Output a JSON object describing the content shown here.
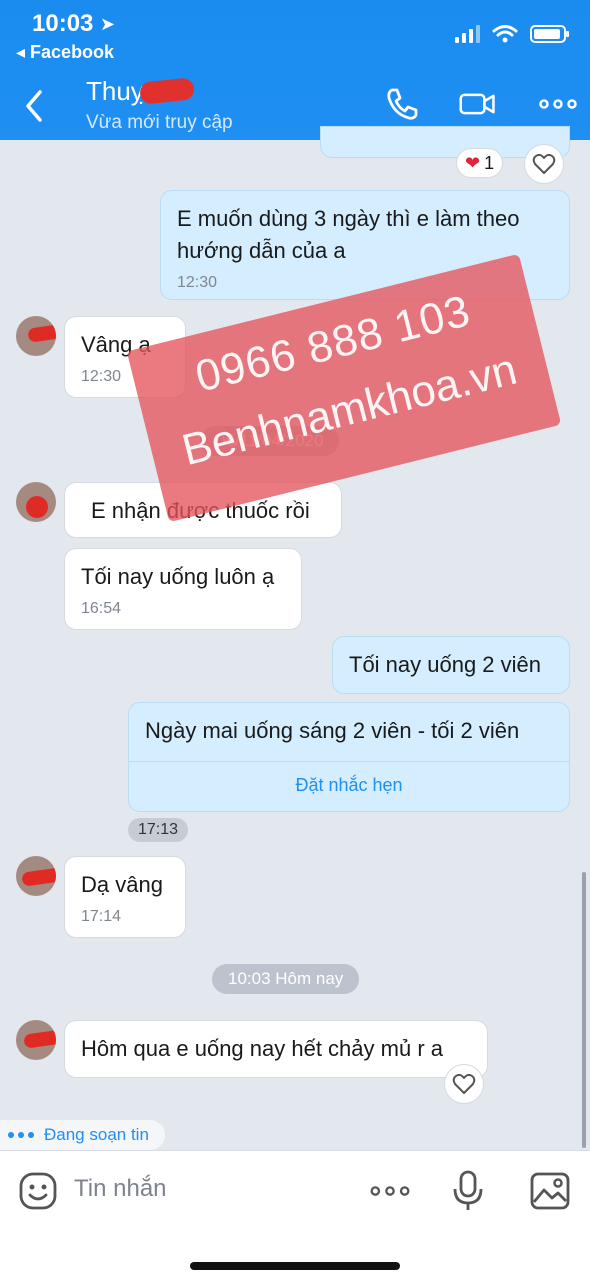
{
  "status": {
    "time": "10:03",
    "back_app": "◂ Facebook"
  },
  "header": {
    "name": "Thuỵ",
    "status": "Vừa mới truy cập"
  },
  "messages": {
    "react_count": "1",
    "m1_text_l1": "E muốn dùng 3 ngày thì e làm theo",
    "m1_text_l2": "hướng dẫn của a",
    "m1_time": "12:30",
    "m2_text": "Vâng ạ",
    "m2_time": "12:30",
    "date_pill": "05/11/04/2020",
    "m3_text": "E nhận được thuốc rồi",
    "m4_text": "Tối nay uống luôn ạ",
    "m4_time": "16:54",
    "m5_text": "Tối nay uống 2 viên",
    "m6_text": "Ngày mai uống sáng 2 viên - tối 2 viên",
    "m6_reminder": "Đặt nhắc hẹn",
    "m6_time": "17:13",
    "m7_text": "Dạ vâng",
    "m7_time": "17:14",
    "today_pill": "10:03 Hôm nay",
    "m8_text": "Hôm qua e uống nay hết chảy mủ r a"
  },
  "watermark": {
    "phone": "0966 888 103",
    "site": "Benhnamkhoa.vn"
  },
  "typing": "Đang soạn tin",
  "composer": {
    "placeholder": "Tin nhắn"
  },
  "icons": [
    "location-arrow-icon",
    "signal-icon",
    "wifi-icon",
    "battery-icon",
    "back-icon",
    "phone-icon",
    "video-icon",
    "more-icon",
    "heart-icon",
    "emoji-icon",
    "mic-icon",
    "image-icon"
  ],
  "colors": {
    "header": "#1f8ff2",
    "outgoing": "#d4eeff",
    "incoming": "#ffffff",
    "watermark": "#e6545c"
  }
}
